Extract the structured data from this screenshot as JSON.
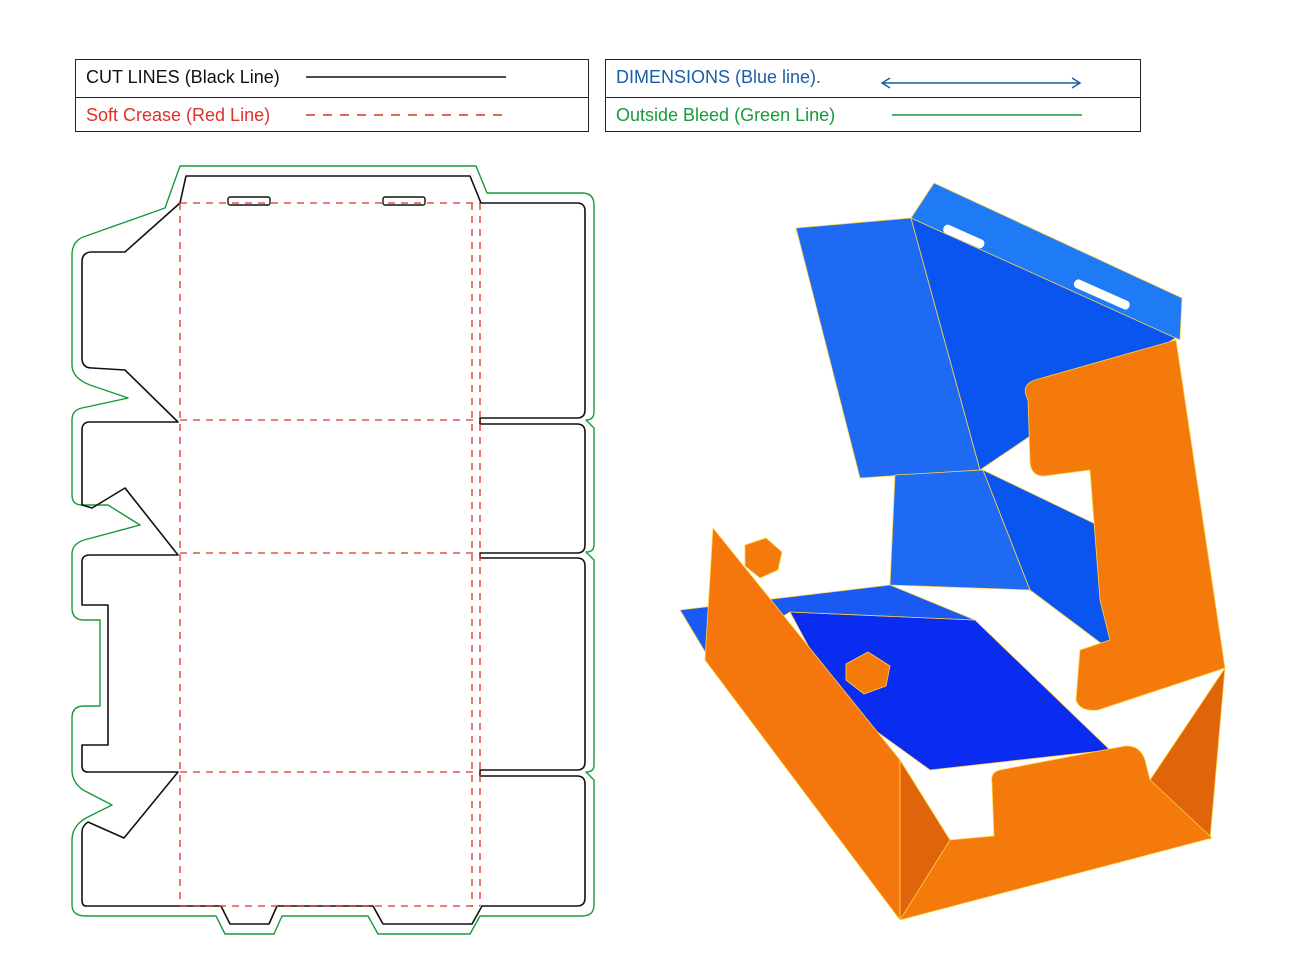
{
  "legend": {
    "left": {
      "rows": [
        {
          "label": "CUT LINES (Black Line)",
          "color": "#111111",
          "style": "solid"
        },
        {
          "label": "Soft Crease (Red Line)",
          "color": "#e0302a",
          "style": "dashed"
        }
      ]
    },
    "right": {
      "rows": [
        {
          "label": "DIMENSIONS (Blue line).",
          "color": "#1a5ea8",
          "style": "double-arrow"
        },
        {
          "label": "Outside Bleed (Green Line)",
          "color": "#1a9a3a",
          "style": "solid"
        }
      ]
    }
  },
  "colors": {
    "cut": "#111111",
    "crease": "#e0302a",
    "bleed": "#1a9a3a",
    "box_orange": "#f47a0c",
    "box_orange_dark": "#e0650a",
    "box_blue": "#1e6af2",
    "box_blue_deep": "#0a3af0"
  }
}
